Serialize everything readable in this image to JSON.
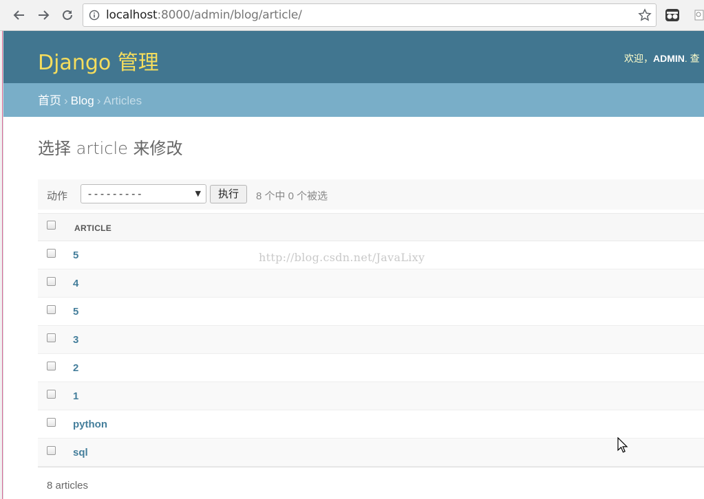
{
  "browser": {
    "url_host": "localhost",
    "url_rest": ":8000/admin/blog/article/"
  },
  "header": {
    "brand": "Django 管理",
    "welcome": "欢迎，",
    "username": "ADMIN",
    "trailing": ". 查"
  },
  "breadcrumbs": {
    "home": "首页",
    "app": "Blog",
    "current": "Articles",
    "separator": "›"
  },
  "content": {
    "title": "选择 article 来修改"
  },
  "actions": {
    "label": "动作",
    "selected_option": "---------",
    "go_label": "执行",
    "selection_count": "8 个中 0 个被选"
  },
  "table": {
    "column_header": "ARTICLE",
    "rows": [
      "5",
      "4",
      "5",
      "3",
      "2",
      "1",
      "python",
      "sql"
    ]
  },
  "paginator": {
    "text": "8 articles"
  },
  "watermark": "http://blog.csdn.net/JavaLixy",
  "colors": {
    "header_bg": "#417690",
    "brand_yellow": "#f5dd5d",
    "breadcrumb_bg": "#79aec8",
    "link_blue": "#447e9b"
  }
}
